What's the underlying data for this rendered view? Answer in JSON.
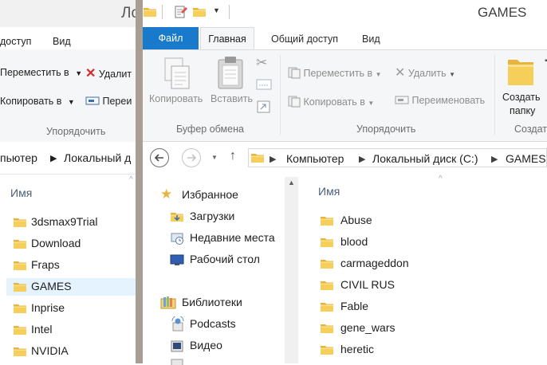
{
  "background_window": {
    "title": "Ло",
    "tabs": [
      "доступ",
      "Вид"
    ],
    "ribbon": {
      "move_to": "Переместить в",
      "copy_to": "Копировать в",
      "delete": "Удалит",
      "rename": "Переи",
      "group": "Упорядочить"
    },
    "address": {
      "crumb1": "пьютер",
      "crumb2": "Локальный д"
    },
    "column": "Имя",
    "items": [
      "3dsmax9Trial",
      "Download",
      "Fraps",
      "GAMES",
      "Inprise",
      "Intel",
      "NVIDIA"
    ]
  },
  "window": {
    "title": "GAMES",
    "tabs": {
      "file": "Файл",
      "home": "Главная",
      "share": "Общий доступ",
      "view": "Вид"
    },
    "ribbon": {
      "copy": "Копировать",
      "paste": "Вставить",
      "clipboard_group": "Буфер обмена",
      "move_to": "Переместить в",
      "copy_to": "Копировать в",
      "delete": "Удалить",
      "rename": "Переименовать",
      "organize_group": "Упорядочить",
      "new_folder_line1": "Создать",
      "new_folder_line2": "папку",
      "create_group": "Создат"
    },
    "address": {
      "crumb1": "Компьютер",
      "crumb2": "Локальный диск (C:)",
      "crumb3": "GAMES"
    },
    "nav": {
      "favorites": "Избранное",
      "downloads": "Загрузки",
      "recent": "Недавние места",
      "desktop": "Рабочий стол",
      "libraries": "Библиотеки",
      "podcasts": "Podcasts",
      "video": "Видео"
    },
    "column": "Имя",
    "items": [
      "Abuse",
      "blood",
      "carmageddon",
      "CIVIL RUS",
      "Fable",
      "gene_wars",
      "heretic"
    ]
  },
  "colors": {
    "file_tab": "#1979ca",
    "folder": "#f0c24b",
    "selection": "#e5f3ff"
  }
}
